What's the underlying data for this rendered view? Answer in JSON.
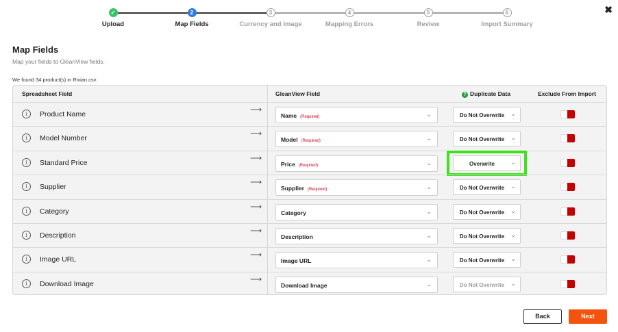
{
  "stepper": {
    "steps": [
      {
        "label": "Upload",
        "num": "✓",
        "state": "done"
      },
      {
        "label": "Map Fields",
        "num": "2",
        "state": "active"
      },
      {
        "label": "Currency and Image",
        "num": "3",
        "state": "future"
      },
      {
        "label": "Mapping Errors",
        "num": "4",
        "state": "future"
      },
      {
        "label": "Review",
        "num": "5",
        "state": "future"
      },
      {
        "label": "Import Summary",
        "num": "6",
        "state": "future"
      }
    ]
  },
  "close_label": "✖",
  "page": {
    "title": "Map Fields",
    "subtitle": "Map your fields to GleanView fields.",
    "found": "We found 34 product(s) in Rivian.csv."
  },
  "table": {
    "headers": {
      "spreadsheet": "Spreadsheet Field",
      "gleanview": "GleanView Field",
      "duplicate": "Duplicate Data",
      "duplicate_help": "?",
      "exclude": "Exclude From Import"
    },
    "arrow": "⟶",
    "info": "i",
    "required_label": "(Required)",
    "rows": [
      {
        "field": "Product Name",
        "mapped": "Name",
        "required": true,
        "duplicate": "Do Not Overwrite",
        "dup_disabled": false
      },
      {
        "field": "Model Number",
        "mapped": "Model",
        "required": true,
        "duplicate": "Do Not Overwrite",
        "dup_disabled": false
      },
      {
        "field": "Standard Price",
        "mapped": "Price",
        "required": true,
        "duplicate": "Overwrite",
        "dup_disabled": false,
        "highlighted": true
      },
      {
        "field": "Supplier",
        "mapped": "Supplier",
        "required": true,
        "duplicate": "Do Not Overwrite",
        "dup_disabled": false
      },
      {
        "field": "Category",
        "mapped": "Category",
        "required": false,
        "duplicate": "Do Not Overwrite",
        "dup_disabled": false
      },
      {
        "field": "Description",
        "mapped": "Description",
        "required": false,
        "duplicate": "Do Not Overwrite",
        "dup_disabled": false
      },
      {
        "field": "Image URL",
        "mapped": "Image URL",
        "required": false,
        "duplicate": "Do Not Overwrite",
        "dup_disabled": false
      },
      {
        "field": "Download Image",
        "mapped": "Download Image",
        "required": false,
        "duplicate": "Do Not Overwrite",
        "dup_disabled": true
      }
    ]
  },
  "buttons": {
    "back": "Back",
    "next": "Next"
  },
  "colors": {
    "accent": "#f5530d",
    "active_step": "#2f7de1",
    "done_step": "#3cc36a",
    "highlight": "#3fe01c",
    "toggle_red": "#c40000",
    "required": "#d0021b"
  }
}
